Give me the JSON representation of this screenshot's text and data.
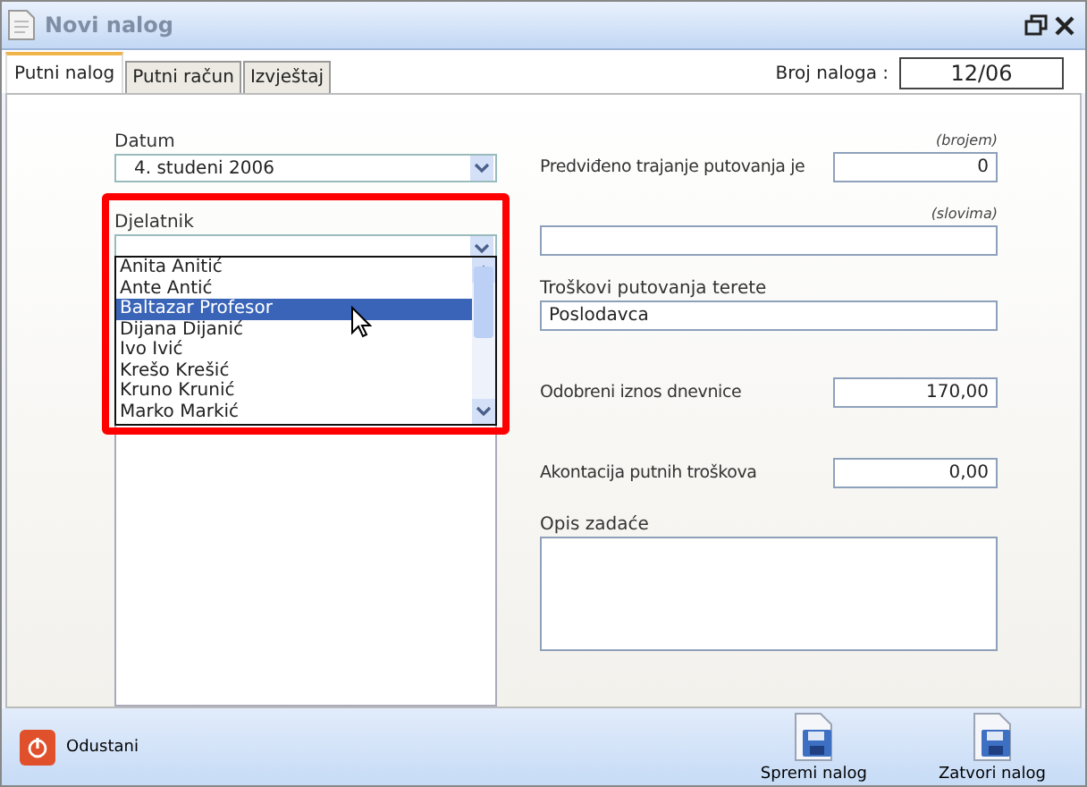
{
  "window": {
    "title": "Novi nalog"
  },
  "tabs": [
    {
      "label": "Putni nalog",
      "selected": true
    },
    {
      "label": "Putni račun",
      "selected": false
    },
    {
      "label": "Izvještaj",
      "selected": false
    }
  ],
  "order_number": {
    "label": "Broj naloga :",
    "value": "12/06"
  },
  "date": {
    "label": "Datum",
    "value": "4. studeni 2006"
  },
  "employee": {
    "label": "Djelatnik",
    "options": [
      {
        "label": "Anita Anitić",
        "selected": false
      },
      {
        "label": "Ante Antić",
        "selected": false
      },
      {
        "label": "Baltazar Profesor",
        "selected": true
      },
      {
        "label": "Dijana Dijanić",
        "selected": false
      },
      {
        "label": "Ivo Ivić",
        "selected": false
      },
      {
        "label": "Krešo Krešić",
        "selected": false
      },
      {
        "label": "Kruno Krunić",
        "selected": false
      },
      {
        "label": "Marko Markić",
        "selected": false
      }
    ]
  },
  "fields": [
    {
      "kind": "inline",
      "hint": "(brojem)",
      "label": "Predviđeno trajanje putovanja je",
      "value": "0"
    },
    {
      "kind": "wide",
      "hint": "(slovima)"
    },
    {
      "kind": "wide",
      "label": "Troškovi putovanja terete",
      "value": "Poslodavca"
    },
    {
      "kind": "inline",
      "label": "Odobreni iznos dnevnice",
      "value": "170,00"
    },
    {
      "kind": "inline",
      "label": "Akontacija putnih troškova",
      "value": "0,00"
    },
    {
      "kind": "area",
      "label": "Opis zadaće"
    }
  ],
  "footer": {
    "cancel": "Odustani",
    "actions": [
      "Spremi nalog",
      "Zatvori nalog"
    ]
  }
}
